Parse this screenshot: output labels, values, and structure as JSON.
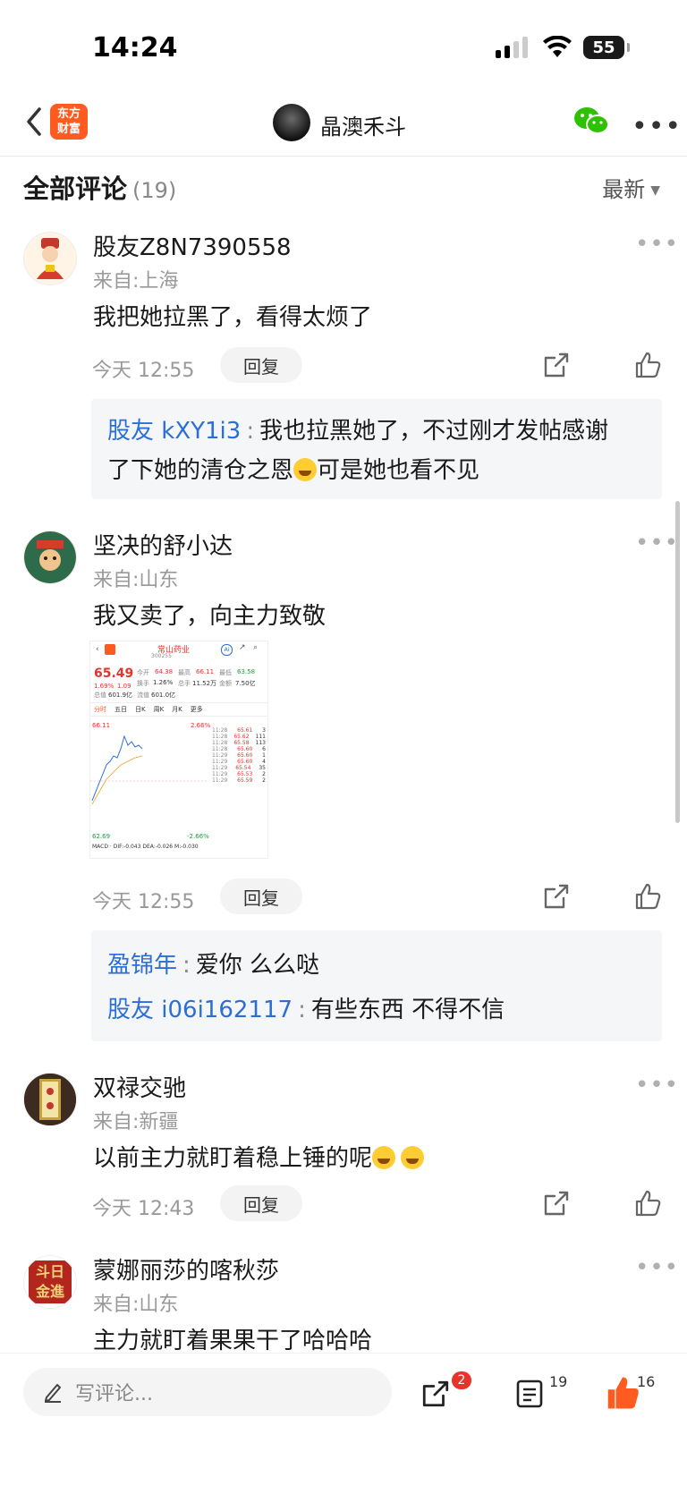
{
  "status": {
    "time": "14:24",
    "battery": "55"
  },
  "header": {
    "author_name": "晶澳禾斗",
    "logo_line1": "东方",
    "logo_line2": "财富"
  },
  "section": {
    "title": "全部评论",
    "count": "(19)",
    "sort": "最新"
  },
  "comments": [
    {
      "username": "股友Z8N7390558",
      "location": "来自:上海",
      "text": "我把她拉黑了，看得太烦了",
      "time": "今天 12:55",
      "reply_label": "回复",
      "replies": [
        {
          "name": "股友 kXY1i3",
          "sep": ":",
          "text_a": "我也拉黑她了，不过刚才发帖感谢",
          "text_b": "了下她的清仓之恩",
          "text_c": "可是她也看不见"
        }
      ]
    },
    {
      "username": "坚决的舒小达",
      "location": "来自:山东",
      "text": "我又卖了，向主力致敬",
      "time": "今天 12:55",
      "reply_label": "回复",
      "replies": [
        {
          "name": "盈锦年",
          "sep": ":",
          "text": "爱你 么么哒"
        },
        {
          "name": "股友 i06i162117",
          "sep": ":",
          "text": "有些东西 不得不信"
        }
      ]
    },
    {
      "username": "双禄交驰",
      "location": "来自:新疆",
      "text": "以前主力就盯着稳上锤的呢",
      "time": "今天 12:43",
      "reply_label": "回复"
    },
    {
      "username": "蒙娜丽莎的喀秋莎",
      "location": "来自:山东",
      "text": "主力就盯着果果干了哈哈哈",
      "avatar_text_a": "斗日",
      "avatar_text_b": "金進"
    }
  ],
  "stock_thumb": {
    "name": "常山药业",
    "code": "300255",
    "price": "65.49",
    "change_pct": "1.69%",
    "change": "1.09",
    "open_label": "今开",
    "open": "64.38",
    "high_label": "最高",
    "high": "66.11",
    "low_label": "最低",
    "low": "63.58",
    "turnover_label": "换手",
    "turnover": "1.26%",
    "volume_label": "总手",
    "volume": "11.52万",
    "amount_label": "金额",
    "amount": "7.50亿",
    "mktcap_label": "总值",
    "mktcap": "601.9亿",
    "float_label": "流值",
    "float": "601.0亿",
    "tabs": [
      "分时",
      "五日",
      "日K",
      "周K",
      "月K",
      "更多"
    ],
    "top_price": "66.11",
    "bottom_price": "62.69",
    "top_pct": "2.66%",
    "bottom_pct": "-2.66%",
    "macd": "MACD · DIF:-0.043 DEA:-0.026 M:-0.030",
    "trades": [
      [
        "11:28",
        "65.61",
        "3"
      ],
      [
        "11:28",
        "65.62",
        "111"
      ],
      [
        "11:28",
        "65.58",
        "113"
      ],
      [
        "11:28",
        "65.60",
        "6"
      ],
      [
        "11:29",
        "65.60",
        "1"
      ],
      [
        "11:29",
        "65.60",
        "4"
      ],
      [
        "11:29",
        "65.54",
        "35"
      ],
      [
        "11:29",
        "65.53",
        "2"
      ],
      [
        "11:29",
        "65.59",
        "2"
      ]
    ]
  },
  "bottom": {
    "placeholder": "写评论...",
    "share_count": "2",
    "comment_count": "19",
    "like_count": "16"
  },
  "colors": {
    "accent": "#ff5a1f",
    "link": "#2b6fd6",
    "badge": "#e8322a"
  }
}
